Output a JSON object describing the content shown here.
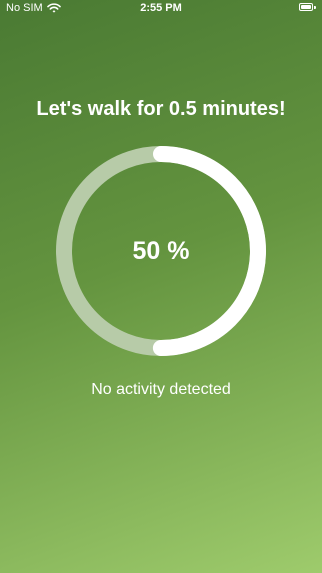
{
  "status_bar": {
    "carrier": "No SIM",
    "time": "2:55 PM",
    "wifi_icon": "wifi-icon",
    "battery_icon": "battery-icon"
  },
  "goal": {
    "title": "Let's walk for 0.5 minutes!"
  },
  "progress": {
    "value": 0.5,
    "label": "50 %",
    "track_color": "#b7cba8",
    "fill_color": "#ffffff"
  },
  "activity": {
    "status": "No activity detected"
  },
  "colors": {
    "background_top": "#4a7a33",
    "background_bottom": "#9ecb6c"
  }
}
